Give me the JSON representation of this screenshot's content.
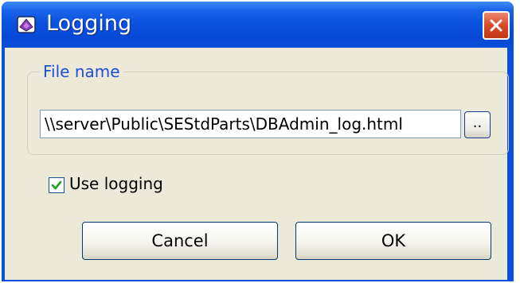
{
  "window": {
    "title": "Logging",
    "icon": "app-book-icon",
    "close_icon": "close-icon"
  },
  "file_group": {
    "legend": "File name",
    "path_value": "\\\\server\\Public\\SEStdParts\\DBAdmin_log.html",
    "browse_label": ".."
  },
  "logging": {
    "checkbox_label": "Use logging",
    "checked": true
  },
  "buttons": {
    "cancel_label": "Cancel",
    "ok_label": "OK"
  },
  "colors": {
    "titlebar": "#0a4ee0",
    "close": "#d94a26",
    "dialog_bg": "#ece9d8",
    "legend_text": "#1f4fd6",
    "check": "#21a121"
  }
}
